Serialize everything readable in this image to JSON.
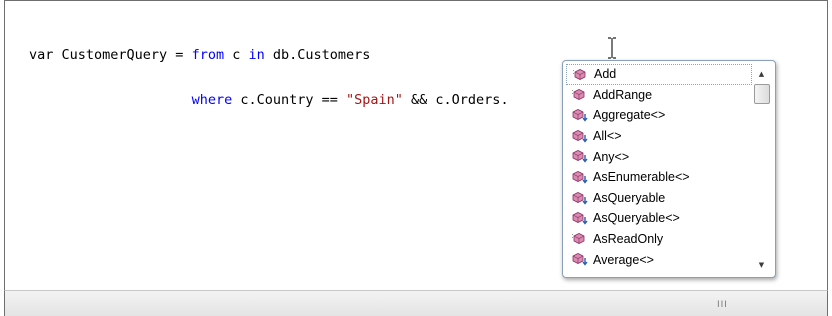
{
  "code": {
    "line1": {
      "a": "var CustomerQuery = ",
      "kw_from": "from",
      "b": " c ",
      "kw_in": "in",
      "c": " db.Customers"
    },
    "line2": {
      "indent": "                    ",
      "kw_where": "where",
      "a": " c.Country == ",
      "str": "\"Spain\"",
      "b": " && c.Orders."
    }
  },
  "intellisense": {
    "items": [
      {
        "label": "Add",
        "icon": "method-icon",
        "selected": true
      },
      {
        "label": "AddRange",
        "icon": "method-icon",
        "selected": false
      },
      {
        "label": "Aggregate<>",
        "icon": "extension-method-icon",
        "selected": false
      },
      {
        "label": "All<>",
        "icon": "extension-method-icon",
        "selected": false
      },
      {
        "label": "Any<>",
        "icon": "extension-method-icon",
        "selected": false
      },
      {
        "label": "AsEnumerable<>",
        "icon": "extension-method-icon",
        "selected": false
      },
      {
        "label": "AsQueryable",
        "icon": "extension-method-icon",
        "selected": false
      },
      {
        "label": "AsQueryable<>",
        "icon": "extension-method-icon",
        "selected": false
      },
      {
        "label": "AsReadOnly",
        "icon": "method-icon",
        "selected": false
      },
      {
        "label": "Average<>",
        "icon": "extension-method-icon",
        "selected": false
      }
    ],
    "scroll_up": "▲",
    "scroll_down": "▼"
  },
  "hscroll": {
    "grip": "III"
  },
  "colors": {
    "keyword": "#0000ff",
    "string": "#a31515"
  }
}
